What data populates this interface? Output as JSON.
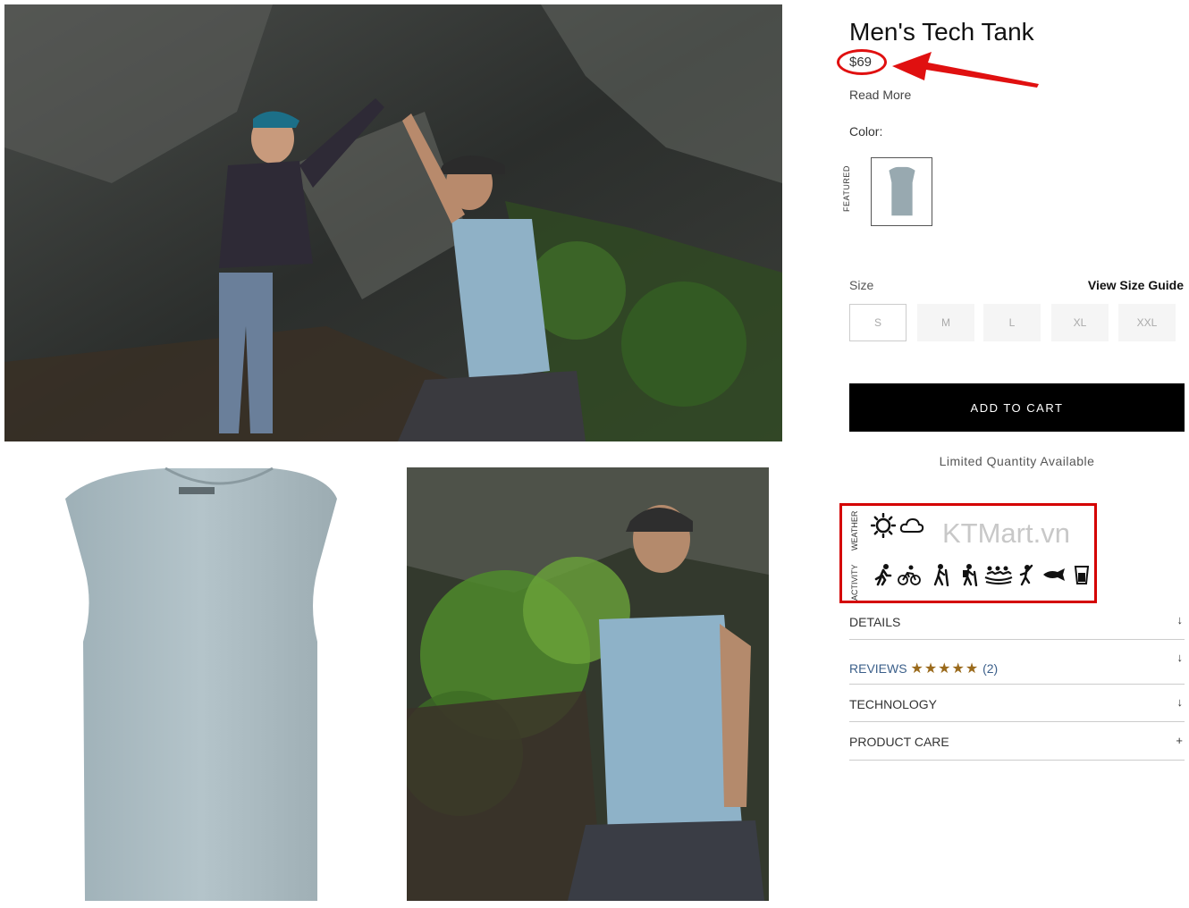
{
  "product": {
    "title": "Men's Tech Tank",
    "price": "$69",
    "read_more": "Read More"
  },
  "color": {
    "label": "Color:",
    "group_label": "FEATURED",
    "selected_swatch": "light-blue-heather"
  },
  "size": {
    "label": "Size",
    "guide_link": "View Size Guide",
    "options": [
      "S",
      "M",
      "L",
      "XL",
      "XXL"
    ]
  },
  "cart": {
    "add_label": "ADD TO CART",
    "availability": "Limited Quantity Available"
  },
  "conditions": {
    "weather_label": "WEATHER",
    "activity_label": "ACTIVITY",
    "watermark": "KTMart.vn",
    "weather_icons": [
      "sun-icon",
      "cloud-icon"
    ],
    "activity_icons": [
      "running-icon",
      "cycling-icon",
      "hiking-icon",
      "backpacking-icon",
      "rafting-icon",
      "climbing-icon",
      "fishing-icon",
      "drink-icon"
    ]
  },
  "accordion": {
    "details": "DETAILS",
    "reviews": "REVIEWS",
    "reviews_stars": "★★★★★",
    "reviews_count": "(2)",
    "technology": "TECHNOLOGY",
    "product_care": "PRODUCT CARE",
    "expand_sign": "↓",
    "plus_sign": "+"
  },
  "colors": {
    "accent_red": "#e01010",
    "cart_button": "#000000",
    "review_link": "#3b5f8a",
    "star_color": "#9a6a1c"
  }
}
